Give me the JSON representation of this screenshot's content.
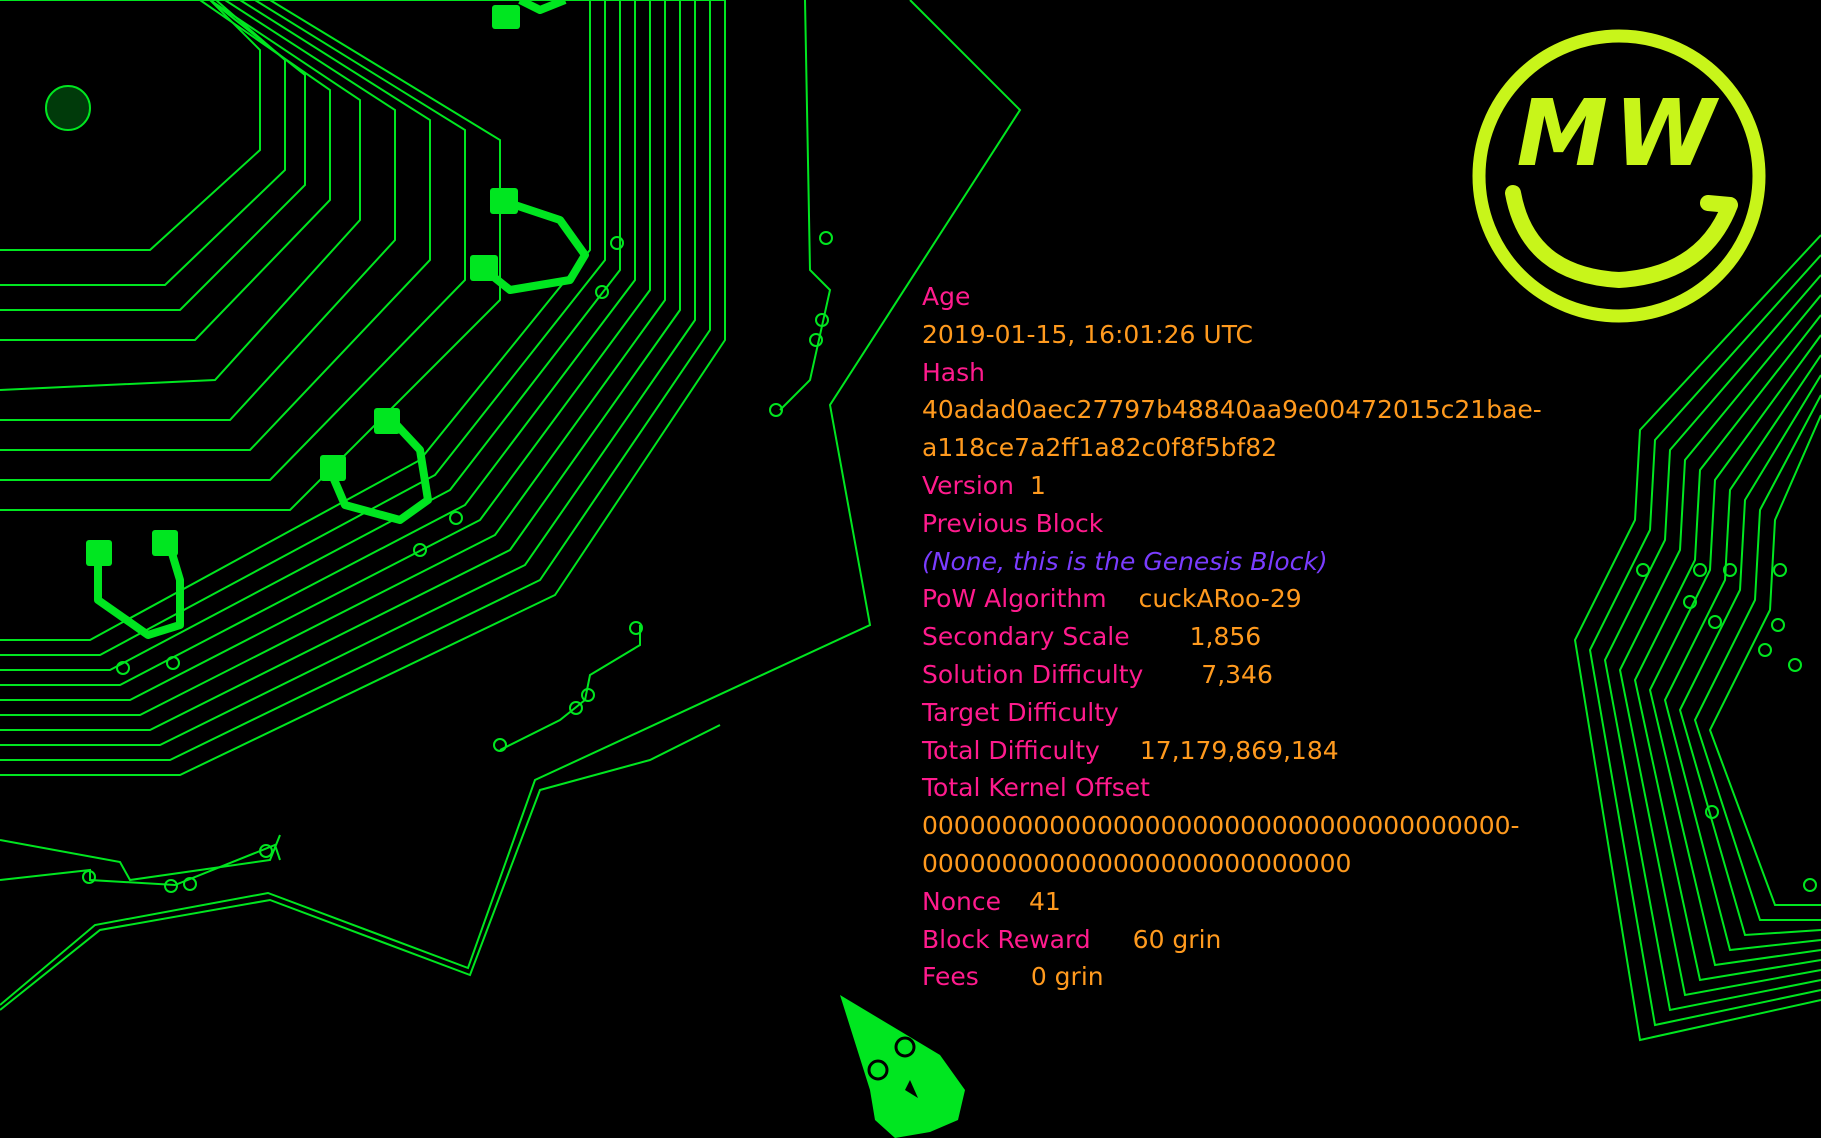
{
  "colors": {
    "background": "#000000",
    "circuit": "#00e620",
    "label": "#ff1b8d",
    "value": "#ff9a1e",
    "genesis_note": "#7a3cff",
    "logo": "#c8f51a"
  },
  "logo": {
    "icon": "grin-smiley-logo-icon",
    "text": "MW"
  },
  "block": {
    "age_label": "Age",
    "age_value": "2019-01-15, 16:01:26 UTC",
    "hash_label": "Hash",
    "hash_line1": "40adad0aec27797b48840aa9e00472015c21bae-",
    "hash_line2": "a118ce7a2ff1a82c0f8f5bf82",
    "version_label": "Version",
    "version_value": "1",
    "prev_label": "Previous Block",
    "prev_value": "(None, this is the Genesis Block)",
    "pow_label": "PoW Algorithm",
    "pow_value": "cuckARoo-29",
    "secondary_label": "Secondary Scale",
    "secondary_value": "1,856",
    "solution_label": "Solution Difficulty",
    "solution_value": "7,346",
    "target_label": "Target Difficulty",
    "total_diff_label": "Total Difficulty",
    "total_diff_value": "17,179,869,184",
    "offset_label": "Total Kernel Offset",
    "offset_line1": "0000000000000000000000000000000000000-",
    "offset_line2": "000000000000000000000000000",
    "nonce_label": "Nonce",
    "nonce_value": "41",
    "reward_label": "Block Reward",
    "reward_value": "60 grin",
    "fees_label": "Fees",
    "fees_value": "0 grin"
  }
}
